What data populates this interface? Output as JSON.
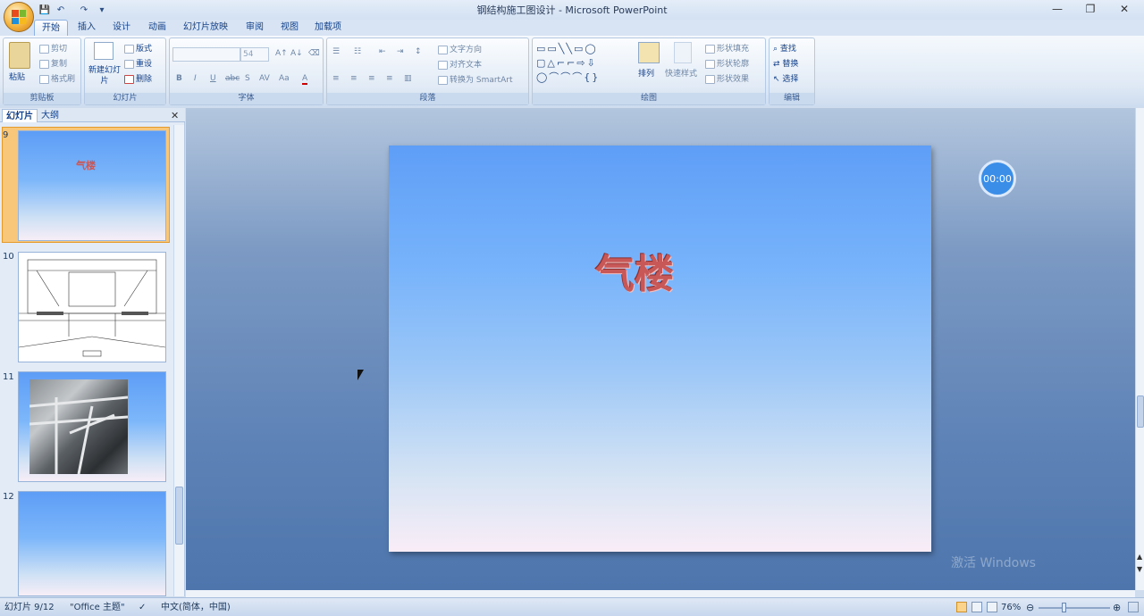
{
  "window": {
    "title": "钢结构施工图设计 - Microsoft PowerPoint",
    "controls": {
      "minimize": "—",
      "restore": "❐",
      "close": "✕"
    }
  },
  "qat": {
    "save": "💾",
    "undo": "↶",
    "redo": "↷",
    "more": "▾"
  },
  "tabs": [
    "开始",
    "插入",
    "设计",
    "动画",
    "幻灯片放映",
    "审阅",
    "视图",
    "加载项"
  ],
  "ribbon": {
    "clipboard": {
      "label": "剪贴板",
      "paste": "粘贴",
      "cut": "剪切",
      "copy": "复制",
      "format_painter": "格式刷"
    },
    "slides": {
      "label": "幻灯片",
      "new_slide": "新建幻灯片",
      "layout": "版式",
      "reset": "重设",
      "delete": "删除"
    },
    "font": {
      "label": "字体",
      "font_name": "",
      "font_size": "54",
      "bold": "B",
      "italic": "I",
      "underline": "U",
      "strike": "abc",
      "shadow": "S",
      "spacing": "AV",
      "case": "Aa",
      "color": "A"
    },
    "paragraph": {
      "label": "段落",
      "text_direction": "文字方向",
      "align_text": "对齐文本",
      "smartart": "转换为 SmartArt"
    },
    "drawing": {
      "label": "绘图",
      "arrange": "排列",
      "quick_styles": "快速样式",
      "shape_fill": "形状填充",
      "shape_outline": "形状轮廓",
      "shape_effects": "形状效果"
    },
    "editing": {
      "label": "编辑",
      "find": "查找",
      "replace": "替换",
      "select": "选择"
    }
  },
  "side_panel": {
    "tab_slides": "幻灯片",
    "tab_outline": "大纲",
    "close": "✕",
    "thumbnails": [
      {
        "num": "9",
        "title": "气楼",
        "selected": true
      },
      {
        "num": "10",
        "title": ""
      },
      {
        "num": "11",
        "title": ""
      },
      {
        "num": "12",
        "title": ""
      }
    ]
  },
  "slide": {
    "title": "气楼"
  },
  "timer": "00:00",
  "watermark": "激活 Windows",
  "status": {
    "slide_info": "幻灯片 9/12",
    "theme": "\"Office 主题\"",
    "language": "中文(简体，中国)",
    "zoom": "76%"
  },
  "colors": {
    "accent": "#15428b",
    "slide_title": "#c85858",
    "timer_bg": "#3b8ee8"
  }
}
